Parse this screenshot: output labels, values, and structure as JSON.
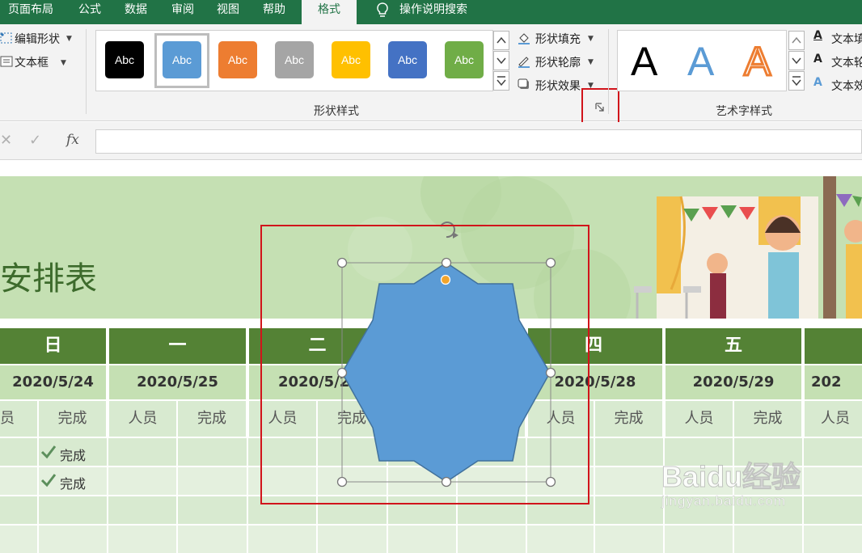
{
  "menu": {
    "tabs": [
      "页面布局",
      "公式",
      "数据",
      "审阅",
      "视图",
      "帮助",
      "格式"
    ],
    "active_tab": "格式",
    "search_label": "操作说明搜索",
    "search_icon": "lightbulb-icon"
  },
  "ribbon": {
    "insert_group": {
      "edit_shape_label": "编辑形状",
      "textbox_label": "文本框"
    },
    "shape_styles": {
      "label": "形状样式",
      "swatch_text": "Abc",
      "swatches": [
        {
          "color": "#000000"
        },
        {
          "color": "#5b9bd5",
          "selected": true
        },
        {
          "color": "#ed7d31"
        },
        {
          "color": "#a5a5a5"
        },
        {
          "color": "#ffc000"
        },
        {
          "color": "#4472c4"
        },
        {
          "color": "#70ad47"
        }
      ],
      "fill_label": "形状填充",
      "outline_label": "形状轮廓",
      "effects_label": "形状效果"
    },
    "wordart_styles": {
      "label": "艺术字样式",
      "letter": "A",
      "text_fill_label": "文本填",
      "text_outline_label": "文本轮",
      "text_effects_label": "文本效"
    }
  },
  "formula_bar": {
    "cancel_icon": "✕",
    "enter_icon": "✓",
    "fx_label": "fx",
    "value": ""
  },
  "sheet": {
    "title": "安排表",
    "days": [
      {
        "day": "日",
        "date": "2020/5/24"
      },
      {
        "day": "一",
        "date": "2020/5/25"
      },
      {
        "day": "二",
        "date": "2020/5/2"
      },
      {
        "day": "四",
        "date": "2020/5/28"
      },
      {
        "day": "五",
        "date": "2020/5/29"
      },
      {
        "day": "",
        "date": "202"
      }
    ],
    "sub_headers": [
      "员",
      "完成",
      "人员",
      "完成",
      "人员",
      "完成",
      "人员",
      "完成",
      "人员",
      "完成",
      "人员"
    ],
    "done_label": "完成",
    "done_rows": 2
  },
  "selection": {
    "shape": "8-point star",
    "fill": "#5b9bd5",
    "outline": "#41719c",
    "handle_color": "#ffffff",
    "adjust_handle_color": "#f2a42b"
  },
  "watermark": {
    "brand": "Baidu经验",
    "url": "jingyan.baidu.com"
  },
  "colors": {
    "menubar": "#217346",
    "ribbon": "#f3f3f3",
    "header_green": "#548235",
    "highlight_red": "#d1141b"
  }
}
